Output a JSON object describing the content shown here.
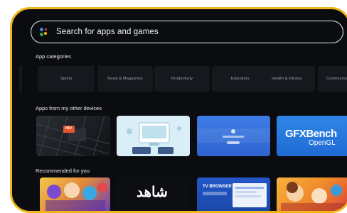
{
  "search": {
    "placeholder": "Search for apps and games",
    "icon": "google-assistant-icon"
  },
  "categories": {
    "title": "App categories",
    "items": [
      "Sports",
      "News & Magazines",
      "Productivity",
      "Education",
      "Health & Fitness",
      "Communication"
    ]
  },
  "other_devices": {
    "title": "Apps from my other devices",
    "apps": [
      {
        "name": "ntv app",
        "badge": "ntv"
      },
      {
        "name": "Device sync app"
      },
      {
        "name": "Blue setup app"
      },
      {
        "name": "GFXBench OpenGL",
        "line1": "GFXBench",
        "line2": "OpenGL"
      }
    ]
  },
  "recommended": {
    "title": "Recommended for you",
    "apps": [
      {
        "name": "Cartoon app"
      },
      {
        "name": "Shahid",
        "label": "شاهد"
      },
      {
        "name": "TV Browser",
        "label": "TV BROWSER"
      },
      {
        "name": "Kids animated app"
      }
    ]
  },
  "colors": {
    "frame_border": "#f1b51c",
    "background": "#0b0c10",
    "accent_blue": "#2f6fde"
  }
}
